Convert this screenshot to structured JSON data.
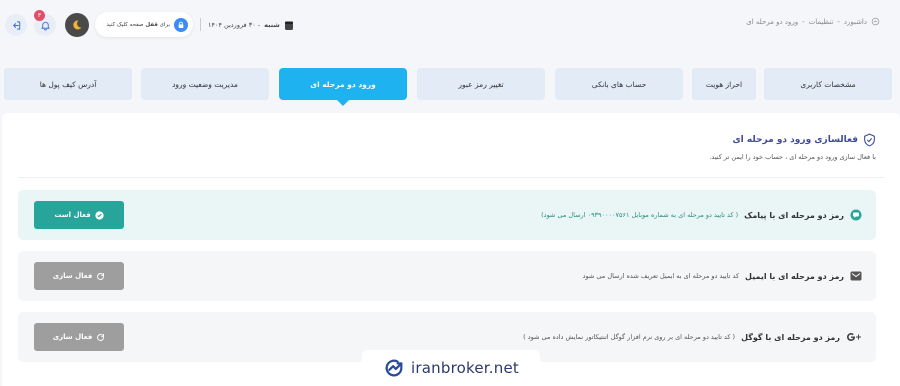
{
  "header": {
    "breadcrumb": [
      "داشبورد",
      "تنظیمات",
      "ورود دو مرحله ای"
    ],
    "date_day": "شنبه",
    "date_rest": "- ۳۰ فروردین ۱۴۰۴",
    "lock_hint_prefix": "برای",
    "lock_hint_bold": "قفل",
    "lock_hint_suffix": "صفحه کلیک کنید",
    "notification_count": "۳"
  },
  "tabs": [
    {
      "label": "مشخصات کاربری",
      "active": false
    },
    {
      "label": "احراز هویت",
      "active": false
    },
    {
      "label": "حساب های بانکی",
      "active": false
    },
    {
      "label": "تغییر رمز عبور",
      "active": false
    },
    {
      "label": "ورود دو مرحله ای",
      "active": true
    },
    {
      "label": "مدیریت وضعیت ورود",
      "active": false
    },
    {
      "label": "آدرس کیف پول ها",
      "active": false
    }
  ],
  "section": {
    "title": "فعالسازی ورود دو مرحله ای",
    "description": "با فعال سازی ورود دو مرحله ای ، حساب خود را ایمن تر کنید."
  },
  "methods": [
    {
      "title": "رمز دو مرحله ای با پیامک",
      "description": "( کد تایید دو مرحله ای به شماره موبایل ۰۹۳۹۰۰۰۰۷۵۶۱ ارسال می شود)",
      "button_label": "فعال است",
      "status": "enabled"
    },
    {
      "title": "رمز دو مرحله ای با ایمیل",
      "description": "کد تایید دو مرحله ای به ایمیل تعریف شده ارسال می شود",
      "button_label": "فعال سازی",
      "status": "disabled"
    },
    {
      "title": "رمز دو مرحله ای با گوگل",
      "description": "( کد تایید دو مرحله ای بر روی نرم افزار گوگل اتنتیکاتور نمایش داده می شود )",
      "button_label": "فعال سازی",
      "status": "disabled"
    }
  ],
  "watermark": {
    "text": "iranbroker.net"
  },
  "colors": {
    "accent": "#1fb2f0",
    "title": "#3c4b9a",
    "enabled_button": "#27a59a",
    "disabled_button": "#9e9e9e",
    "tab_bg": "#e3ebf7"
  },
  "icons": {
    "logout": "logout-icon",
    "bell": "bell-icon",
    "avatar": "moon-icon",
    "lock": "lock-icon",
    "calendar": "calendar-icon",
    "home": "home-icon",
    "shield": "shield-check-icon",
    "sms": "message-icon",
    "email": "envelope-icon",
    "google": "google-plus-icon",
    "check": "check-circle-icon",
    "refresh": "refresh-icon"
  }
}
